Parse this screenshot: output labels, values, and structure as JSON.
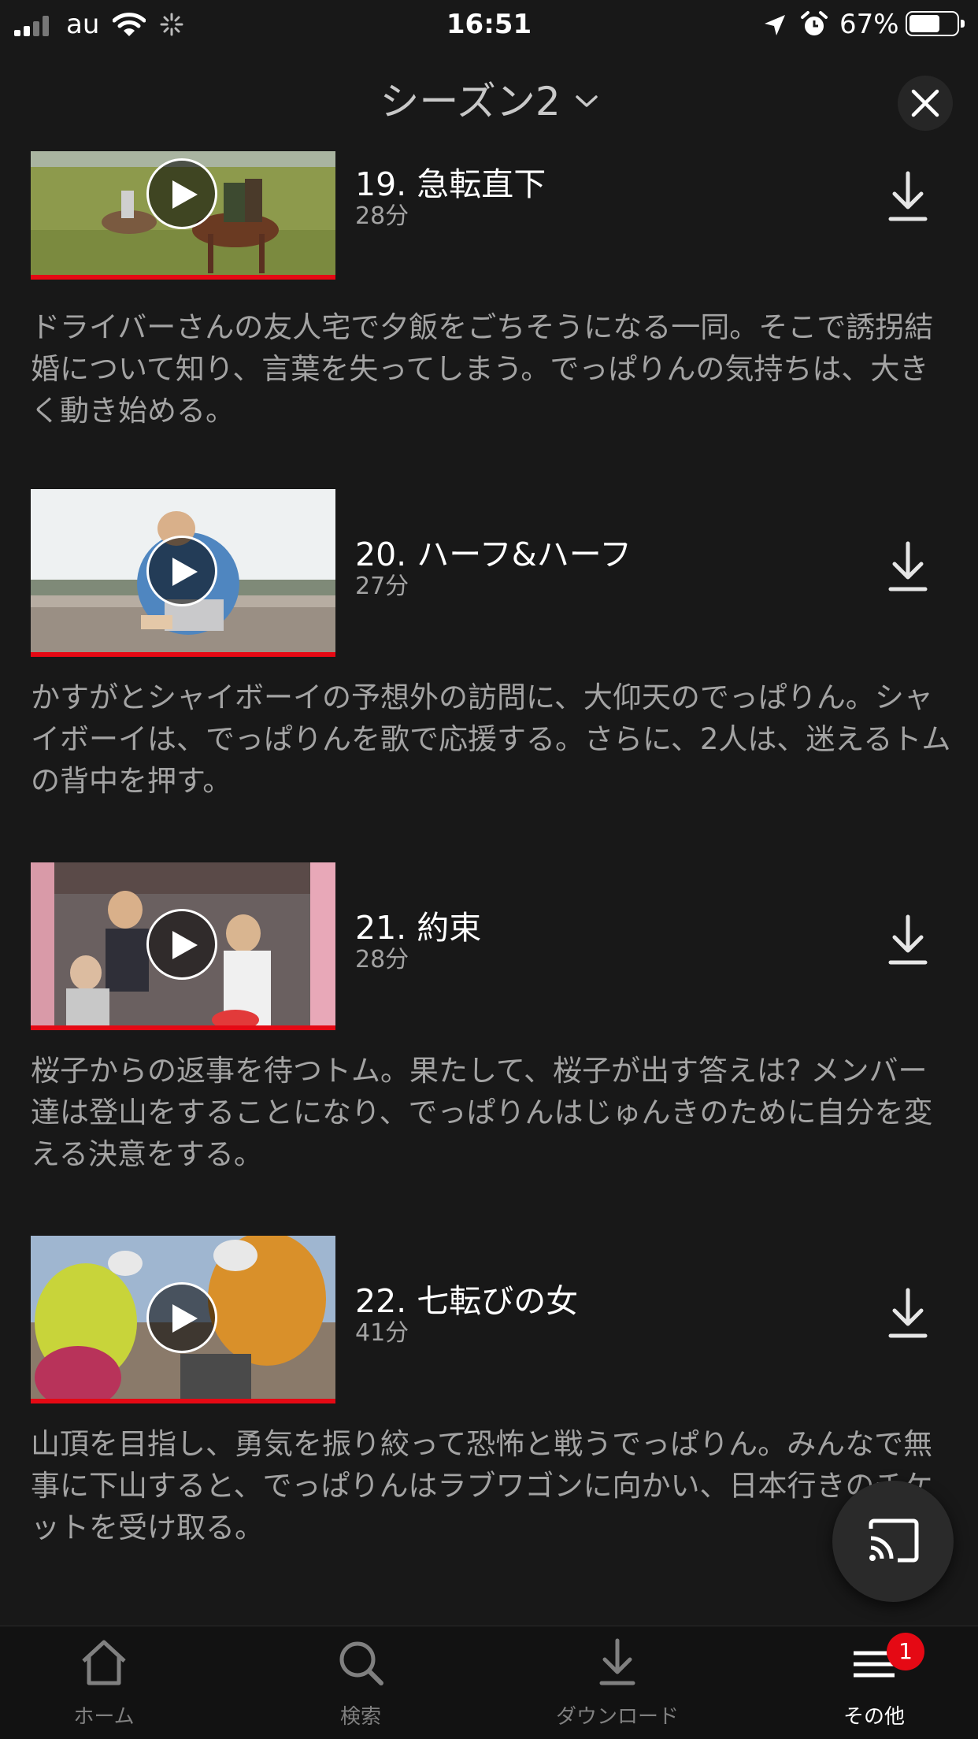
{
  "status_bar": {
    "carrier": "au",
    "time": "16:51",
    "battery_percent": "67%",
    "battery_level": 0.67
  },
  "header": {
    "season_label": "シーズン2"
  },
  "episodes": [
    {
      "title": "19. 急転直下",
      "duration": "28分",
      "synopsis": "ドライバーさんの友人宅で夕飯をごちそうになる一同。そこで誘拐結婚について知り、言葉を失ってしまう。でっぱりんの気持ちは、大きく動き始める。"
    },
    {
      "title": "20. ハーフ&ハーフ",
      "duration": "27分",
      "synopsis": "かすがとシャイボーイの予想外の訪問に、大仰天のでっぱりん。シャイボーイは、でっぱりんを歌で応援する。さらに、2人は、迷えるトムの背中を押す。"
    },
    {
      "title": "21. 約束",
      "duration": "28分",
      "synopsis": "桜子からの返事を待つトム。果たして、桜子が出す答えは? メンバー達は登山をすることになり、でっぱりんはじゅんきのために自分を変える決意をする。"
    },
    {
      "title": "22. 七転びの女",
      "duration": "41分",
      "synopsis": "山頂を目指し、勇気を振り絞って恐怖と戦うでっぱりん。みんなで無事に下山すると、でっぱりんはラブワゴンに向かい、日本行きのチケットを受け取る。"
    }
  ],
  "tab_bar": {
    "home": "ホーム",
    "search": "検索",
    "downloads": "ダウンロード",
    "more": "その他",
    "more_badge": "1"
  },
  "colors": {
    "background": "#181818",
    "progress": "#e50914",
    "secondary_text": "#a3a3a3"
  }
}
